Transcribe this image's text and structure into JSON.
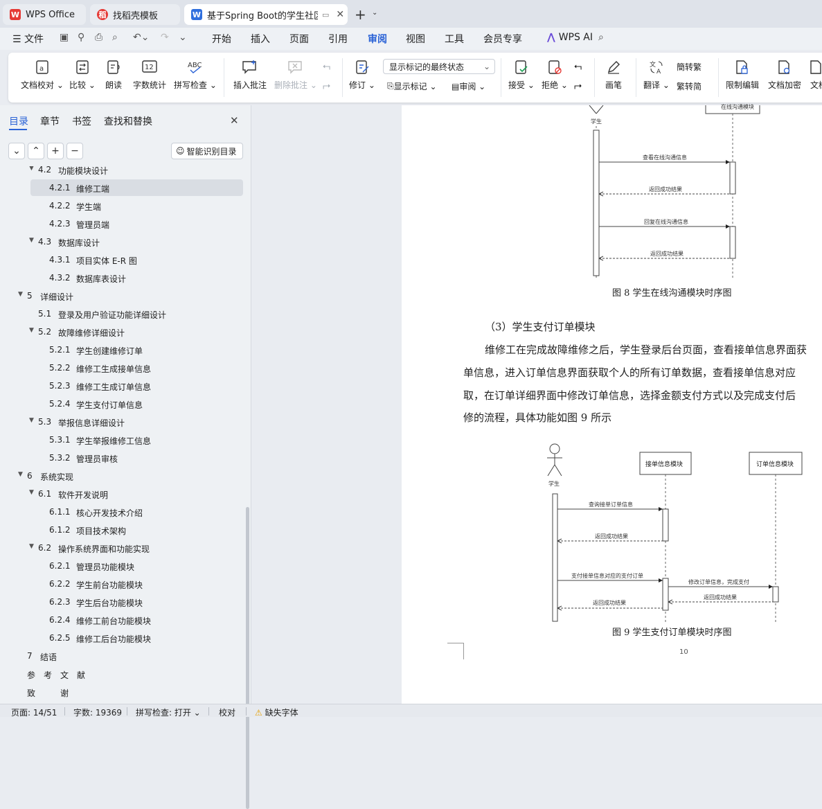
{
  "tabs": [
    {
      "label": "WPS Office",
      "icon": "wps-logo-icon",
      "active": false
    },
    {
      "label": "找稻壳模板",
      "icon": "docer-icon",
      "active": false
    },
    {
      "label": "基于Spring Boot的学生社区...",
      "icon": "word-doc-icon",
      "active": true
    }
  ],
  "menu": {
    "file": "文件",
    "items": [
      "开始",
      "插入",
      "页面",
      "引用",
      "审阅",
      "视图",
      "工具",
      "会员专享"
    ],
    "active": "审阅",
    "ai": "WPS AI"
  },
  "ribbon": {
    "proofread": "文档校对",
    "compare": "比较",
    "read_aloud": "朗读",
    "word_count": "字数统计",
    "word_count_icon": "12",
    "spell_check": "拼写检查",
    "spell_icon": "ABC",
    "insert_comment": "插入批注",
    "delete_comment": "删除批注",
    "track": "修订",
    "markup_select": "显示标记的最终状态",
    "show_markup": "显示标记",
    "review": "审阅",
    "accept": "接受",
    "reject": "拒绝",
    "ink": "画笔",
    "translate": "翻译",
    "to_trad": "转繁",
    "to_simp": "转简",
    "restrict": "限制编辑",
    "encrypt": "文档加密",
    "more": "文档"
  },
  "sidebar": {
    "tabs": [
      "目录",
      "章节",
      "书签",
      "查找和替换"
    ],
    "smart_toc": "智能识别目录",
    "toc": [
      {
        "num": "4.2",
        "title": "功能模块设计",
        "level": 2,
        "expand": true
      },
      {
        "num": "4.2.1",
        "title": "维修工端",
        "level": 3,
        "selected": true
      },
      {
        "num": "4.2.2",
        "title": "学生端",
        "level": 3
      },
      {
        "num": "4.2.3",
        "title": "管理员端",
        "level": 3
      },
      {
        "num": "4.3",
        "title": "数据库设计",
        "level": 2,
        "expand": true
      },
      {
        "num": "4.3.1",
        "title": "项目实体 E-R 图",
        "level": 3
      },
      {
        "num": "4.3.2",
        "title": "数据库表设计",
        "level": 3
      },
      {
        "num": "5",
        "title": "详细设计",
        "level": 1,
        "expand": true
      },
      {
        "num": "5.1",
        "title": "登录及用户验证功能详细设计",
        "level": 2
      },
      {
        "num": "5.2",
        "title": "故障维修详细设计",
        "level": 2,
        "expand": true
      },
      {
        "num": "5.2.1",
        "title": "学生创建维修订单",
        "level": 3
      },
      {
        "num": "5.2.2",
        "title": "维修工生成接单信息",
        "level": 3
      },
      {
        "num": "5.2.3",
        "title": "维修工生成订单信息",
        "level": 3
      },
      {
        "num": "5.2.4",
        "title": "学生支付订单信息",
        "level": 3
      },
      {
        "num": "5.3",
        "title": "举报信息详细设计",
        "level": 2,
        "expand": true
      },
      {
        "num": "5.3.1",
        "title": "学生举报维修工信息",
        "level": 3
      },
      {
        "num": "5.3.2",
        "title": "管理员审核",
        "level": 3
      },
      {
        "num": "6",
        "title": "系统实现",
        "level": 1,
        "expand": true
      },
      {
        "num": "6.1",
        "title": "软件开发说明",
        "level": 2,
        "expand": true
      },
      {
        "num": "6.1.1",
        "title": "核心开发技术介绍",
        "level": 3
      },
      {
        "num": "6.1.2",
        "title": "项目技术架构",
        "level": 3
      },
      {
        "num": "6.2",
        "title": "操作系统界面和功能实现",
        "level": 2,
        "expand": true
      },
      {
        "num": "6.2.1",
        "title": "管理员功能模块",
        "level": 3
      },
      {
        "num": "6.2.2",
        "title": "学生前台功能模块",
        "level": 3
      },
      {
        "num": "6.2.3",
        "title": "学生后台功能模块",
        "level": 3
      },
      {
        "num": "6.2.4",
        "title": "维修工前台功能模块",
        "level": 3
      },
      {
        "num": "6.2.5",
        "title": "维修工后台功能模块",
        "level": 3
      },
      {
        "num": "7",
        "title": "结语",
        "level": 1
      },
      {
        "num": "",
        "title": "参　考　文　献",
        "level": 1
      },
      {
        "num": "",
        "title": "致　　　谢",
        "level": 1
      }
    ]
  },
  "doc": {
    "fig8": {
      "actor": "学生",
      "module_top": "在线沟通模块",
      "msg1": "查看在线沟通信息",
      "ret1": "返回成功结果",
      "msg2": "回复在线沟通信息",
      "ret2": "返回成功结果",
      "caption": "图 8  学生在线沟通模块时序图"
    },
    "heading": "（3）学生支付订单模块",
    "para": [
      "维修工在完成故障维修之后，学生登录后台页面，查看接单信息界面获",
      "单信息，进入订单信息界面获取个人的所有订单数据，查看接单信息对应",
      "取，在订单详细界面中修改订单信息，选择金额支付方式以及完成支付后",
      "修的流程，具体功能如图 9 所示"
    ],
    "fig9": {
      "actor": "学生",
      "lifeline1": "接单信息模块",
      "lifeline2": "订单信息模块",
      "msg1": "查询接单订单信息",
      "ret1": "返回成功结果",
      "msg2": "支付接单信息对应的支付订单",
      "msg3": "修改订单信息，完成支付",
      "ret2": "返回成功结果",
      "ret3": "返回成功结果",
      "caption": "图 9  学生支付订单模块时序图"
    },
    "page_number": "10"
  },
  "status": {
    "page": "页面: 14/51",
    "words": "字数: 19369",
    "spell": "拼写检查: 打开",
    "proof": "校对",
    "missing_font": "缺失字体"
  }
}
